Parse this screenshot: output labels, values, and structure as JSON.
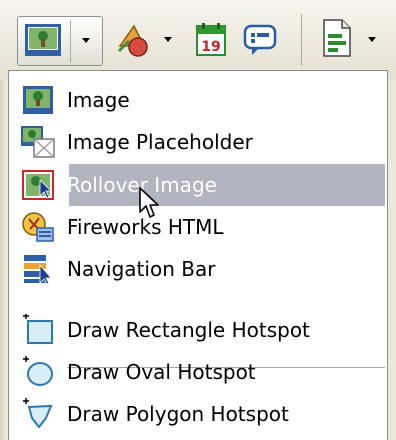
{
  "toolbar": {
    "buttons": [
      {
        "name": "image-button",
        "icon": "image-icon",
        "has_dropdown": true
      },
      {
        "name": "shape-button",
        "icon": "shapes-icon",
        "has_dropdown": true
      },
      {
        "name": "date-button",
        "icon": "calendar-icon",
        "date_label": "19"
      },
      {
        "name": "comment-button",
        "icon": "comment-icon"
      },
      {
        "name": "document-button",
        "icon": "document-icon",
        "has_dropdown": true
      }
    ]
  },
  "menu": {
    "items": [
      {
        "label": "Image",
        "icon": "image-icon"
      },
      {
        "label": "Image Placeholder",
        "icon": "image-placeholder-icon"
      },
      {
        "label": "Rollover Image",
        "icon": "rollover-image-icon",
        "highlighted": true
      },
      {
        "label": "Fireworks HTML",
        "icon": "fireworks-icon"
      },
      {
        "label": "Navigation Bar",
        "icon": "navigation-bar-icon"
      }
    ],
    "hotspot_items": [
      {
        "label": "Draw Rectangle Hotspot",
        "icon": "rectangle-hotspot-icon"
      },
      {
        "label": "Draw Oval Hotspot",
        "icon": "oval-hotspot-icon"
      },
      {
        "label": "Draw Polygon Hotspot",
        "icon": "polygon-hotspot-icon"
      }
    ]
  },
  "colors": {
    "highlight": "#b2b4bf",
    "toolbar_bg": "#ece9d8"
  }
}
